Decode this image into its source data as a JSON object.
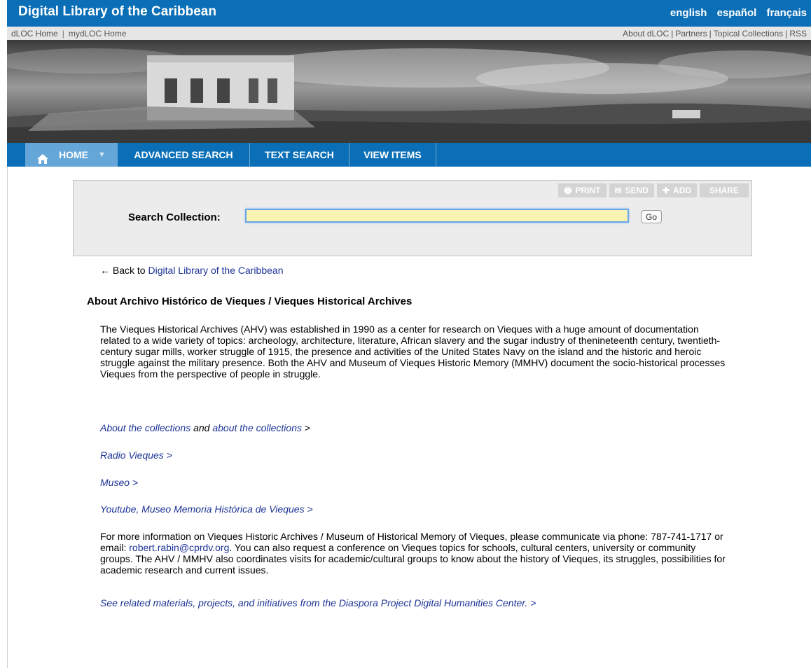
{
  "header": {
    "site_title": "Digital Library of the Caribbean",
    "languages": [
      "english",
      "español",
      "français"
    ]
  },
  "subnav": {
    "left": [
      "dLOC Home",
      "mydLOC Home"
    ],
    "left_sep": "|",
    "right": [
      "About dLOC",
      "Partners",
      "Topical Collections",
      "RSS"
    ],
    "right_sep": "|"
  },
  "mainnav": {
    "home": "HOME",
    "advanced_search": "ADVANCED SEARCH",
    "text_search": "TEXT SEARCH",
    "view_items": "VIEW ITEMS"
  },
  "tools": {
    "print": "PRINT",
    "send": "SEND",
    "add": "ADD",
    "share": "SHARE"
  },
  "search": {
    "label": "Search Collection:",
    "value": "",
    "go": "Go"
  },
  "back": {
    "arrow": "←",
    "prefix": "Back to",
    "link": "Digital Library of the Caribbean"
  },
  "content": {
    "heading": "About Archivo Histórico de Vieques / Vieques Historical Archives",
    "para1": "The Vieques Historical Archives (AHV) was established in 1990 as a center for research on Vieques with a huge amount of documentation related to a wide variety of topics: archeology, architecture, literature, African slavery and the sugar industry of thenineteenth century, twentieth-century sugar mills, worker struggle of 1915, the presence and activities of the United States Navy on the island and the historic and heroic struggle against the military presence. Both the AHV and Museum of Vieques Historic Memory (MMHV) document the socio-historical processes Vieques from the perspective of people in struggle.",
    "link_collections_1": "About the collections",
    "link_and": "and",
    "link_collections_2": "about the collections",
    "link_collections_gt": ">",
    "link_radio": "Radio Vieques >",
    "link_museo": "Museo >",
    "link_youtube": "Youtube, Museo Memoria Histórica de Vieques >",
    "para2_before": "For more information on Vieques Historic Archives / Museum of Historical Memory of Vieques, please communicate via phone: 787-741-1717 or email:",
    "para2_email": "robert.rabin@cprdv.org",
    "para2_after": ". You can also request a conference on Vieques topics for schools, cultural centers, university or community groups. The AHV / MMHV also coordinates visits for academic/cultural groups to know about the history of Vieques, its struggles, possibilities for academic research and current issues.",
    "link_diaspora": "See related materials, projects, and initiatives from the Diaspora Project Digital Humanities Center. >"
  }
}
